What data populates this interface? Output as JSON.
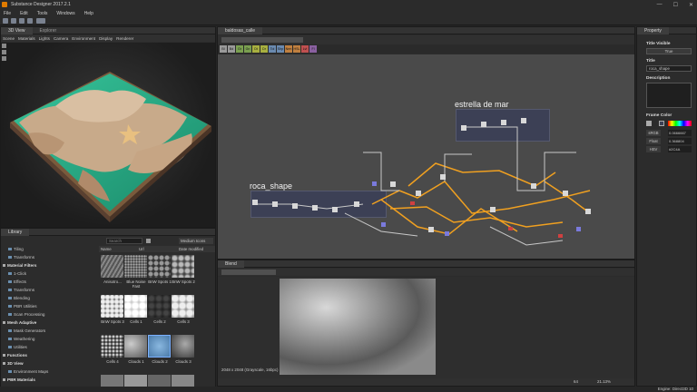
{
  "window": {
    "title": "Substance Designer 2017.2.1",
    "controls": [
      "—",
      "☐",
      "✕"
    ]
  },
  "menu": [
    "File",
    "Edit",
    "Tools",
    "Windows",
    "Help"
  ],
  "view3d": {
    "tabs": [
      "3D View",
      "Explorer"
    ],
    "menu": [
      "Scene",
      "Materials",
      "Lights",
      "Camera",
      "Environment",
      "Display",
      "Renderer"
    ]
  },
  "graph": {
    "tab": "baldosas_calle",
    "frames": [
      "roca_shape",
      "estrella de mar"
    ],
    "toolbar_items": [
      "Bl",
      "Bd",
      "Gr",
      "Gn",
      "Dt",
      "Dr",
      "Tol",
      "Shp",
      "Nrm",
      "HSL",
      "Lvl",
      "Fl"
    ]
  },
  "library": {
    "title": "Library",
    "search_placeholder": "Search",
    "view_mode": "Medium Icons",
    "columns": [
      "Name",
      "Url",
      "Date modified"
    ],
    "tree": [
      {
        "label": "Tiling",
        "type": "item"
      },
      {
        "label": "Transforms",
        "type": "item"
      },
      {
        "label": "Material Filters",
        "type": "cat"
      },
      {
        "label": "1-Click",
        "type": "item"
      },
      {
        "label": "Effects",
        "type": "item"
      },
      {
        "label": "Transforms",
        "type": "item"
      },
      {
        "label": "Blending",
        "type": "item"
      },
      {
        "label": "PBR Utilities",
        "type": "item"
      },
      {
        "label": "Scan Processing",
        "type": "item"
      },
      {
        "label": "Mesh Adaptive",
        "type": "cat"
      },
      {
        "label": "Mask Generators",
        "type": "item"
      },
      {
        "label": "Weathering",
        "type": "item"
      },
      {
        "label": "Utilities",
        "type": "item"
      },
      {
        "label": "Functions",
        "type": "cat"
      },
      {
        "label": "3D View",
        "type": "cat"
      },
      {
        "label": "Environment Maps",
        "type": "item"
      },
      {
        "label": "PBR Materials",
        "type": "cat"
      }
    ],
    "thumbs_row1": [
      "Anisotro...",
      "Blue Noise Fast",
      "BnW Spots 1",
      "BnW Spots 2"
    ],
    "thumbs_row2": [
      "BnW Spots 3",
      "Cells 1",
      "Cells 2",
      "Cells 3"
    ],
    "thumbs_row3": [
      "Cells 4",
      "Clouds 1",
      "Clouds 2",
      "Clouds 3"
    ]
  },
  "blend": {
    "tab": "Blend",
    "info": "2048 x 2048 (Grayscale, 16bpc)",
    "zoom": "21.13%",
    "zoom_extra": "64"
  },
  "property": {
    "tab": "Property",
    "title_visible_label": "Title Visible",
    "title_visible_value": "True",
    "title_label": "Title",
    "title_value": "roca_shape",
    "description_label": "Description",
    "frame_color_label": "Frame Color",
    "color_rows": [
      {
        "mode": "sRGB",
        "value": "0.0666667"
      },
      {
        "mode": "Float",
        "value": "0.368804"
      },
      {
        "mode": "HSV",
        "value": "#2C4A"
      }
    ],
    "modes": [
      "sRGB",
      "Float",
      "HSV"
    ]
  },
  "status": {
    "engine": "Engine: Direct3D 10"
  },
  "colors": {
    "accent": "#f0a020",
    "bg": "#262626",
    "panel": "#2c2c2c",
    "graph_bg": "#4a4a4a",
    "frame": "#3e4356"
  }
}
